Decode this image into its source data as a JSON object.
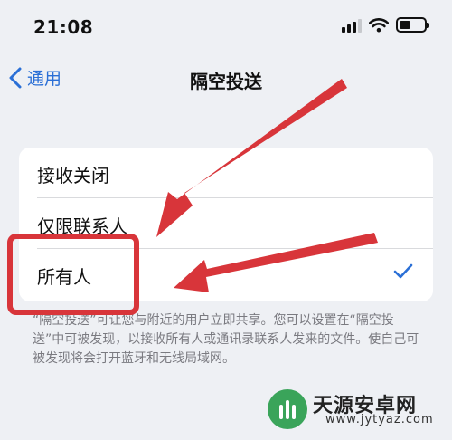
{
  "status_bar": {
    "time": "21:08"
  },
  "nav": {
    "back_label": "通用",
    "title": "隔空投送"
  },
  "options": [
    {
      "label": "接收关闭",
      "selected": false
    },
    {
      "label": "仅限联系人",
      "selected": false
    },
    {
      "label": "所有人",
      "selected": true
    }
  ],
  "footer_note": "“隔空投送”可让您与附近的用户立即共享。您可以设置在“隔空投送”中可被发现，以接收所有人或通讯录联系人发来的文件。使自己可被发现将会打开蓝牙和无线局域网。",
  "colors": {
    "accent": "#2a6fd6",
    "annotation_red": "#d8353a",
    "background": "#eef0f4"
  },
  "watermark": {
    "title": "天源安卓网",
    "url": "www.jytyaz.com"
  }
}
